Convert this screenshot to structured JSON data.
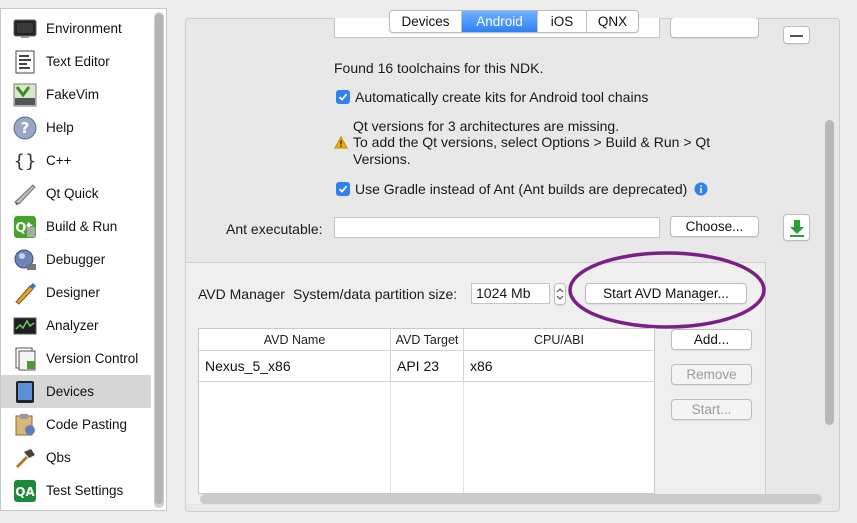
{
  "sidebar": {
    "items": [
      {
        "label": "Environment",
        "icon": "environment-icon"
      },
      {
        "label": "Text Editor",
        "icon": "text-editor-icon"
      },
      {
        "label": "FakeVim",
        "icon": "fakevim-icon"
      },
      {
        "label": "Help",
        "icon": "help-icon"
      },
      {
        "label": "C++",
        "icon": "cpp-braces-icon"
      },
      {
        "label": "Qt Quick",
        "icon": "qt-quick-icon"
      },
      {
        "label": "Build & Run",
        "icon": "build-run-icon"
      },
      {
        "label": "Debugger",
        "icon": "debugger-icon"
      },
      {
        "label": "Designer",
        "icon": "designer-icon"
      },
      {
        "label": "Analyzer",
        "icon": "analyzer-icon"
      },
      {
        "label": "Version Control",
        "icon": "version-control-icon"
      },
      {
        "label": "Devices",
        "icon": "devices-icon",
        "selected": true
      },
      {
        "label": "Code Pasting",
        "icon": "code-pasting-icon"
      },
      {
        "label": "Qbs",
        "icon": "qbs-hammer-icon"
      },
      {
        "label": "Test Settings",
        "icon": "qa-icon"
      }
    ]
  },
  "tabs": [
    {
      "label": "Devices"
    },
    {
      "label": "Android",
      "active": true
    },
    {
      "label": "iOS"
    },
    {
      "label": "QNX"
    }
  ],
  "android": {
    "ndk_status": "Found 16 toolchains for this NDK.",
    "auto_kits_label": "Automatically create kits for Android tool chains",
    "warning_line1": "Qt versions for 3 architectures are missing.",
    "warning_line2": "To add the Qt versions, select Options > Build & Run > Qt",
    "warning_line3": "Versions.",
    "gradle_label": "Use Gradle instead of Ant (Ant builds are deprecated)",
    "ant_label": "Ant executable:",
    "ant_value": "",
    "choose_label": "Choose..."
  },
  "avd": {
    "manager_label": "AVD Manager",
    "partition_label": "System/data partition size:",
    "partition_value": "1024 Mb",
    "start_manager_label": "Start AVD Manager...",
    "columns": [
      "AVD Name",
      "AVD Target",
      "CPU/ABI"
    ],
    "rows": [
      {
        "name": "Nexus_5_x86",
        "target": "API 23",
        "abi": "x86"
      }
    ],
    "add_label": "Add...",
    "remove_label": "Remove",
    "start_label": "Start..."
  },
  "colors": {
    "accent": "#2f80f0",
    "annotation": "#7a1f86",
    "warning": "#f0b400",
    "download": "#2e9d3a"
  }
}
